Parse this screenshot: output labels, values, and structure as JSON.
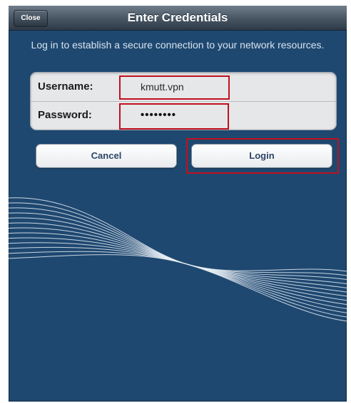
{
  "header": {
    "title": "Enter Credentials",
    "close_label": "Close"
  },
  "message": "Log in to establish a secure connection to your network resources.",
  "form": {
    "username_label": "Username:",
    "username_value": "kmutt.vpn",
    "password_label": "Password:",
    "password_value": "••••••••"
  },
  "buttons": {
    "cancel_label": "Cancel",
    "login_label": "Login"
  },
  "colors": {
    "background": "#1f4870",
    "highlight": "#c0101e",
    "button_text": "#2c4466"
  }
}
